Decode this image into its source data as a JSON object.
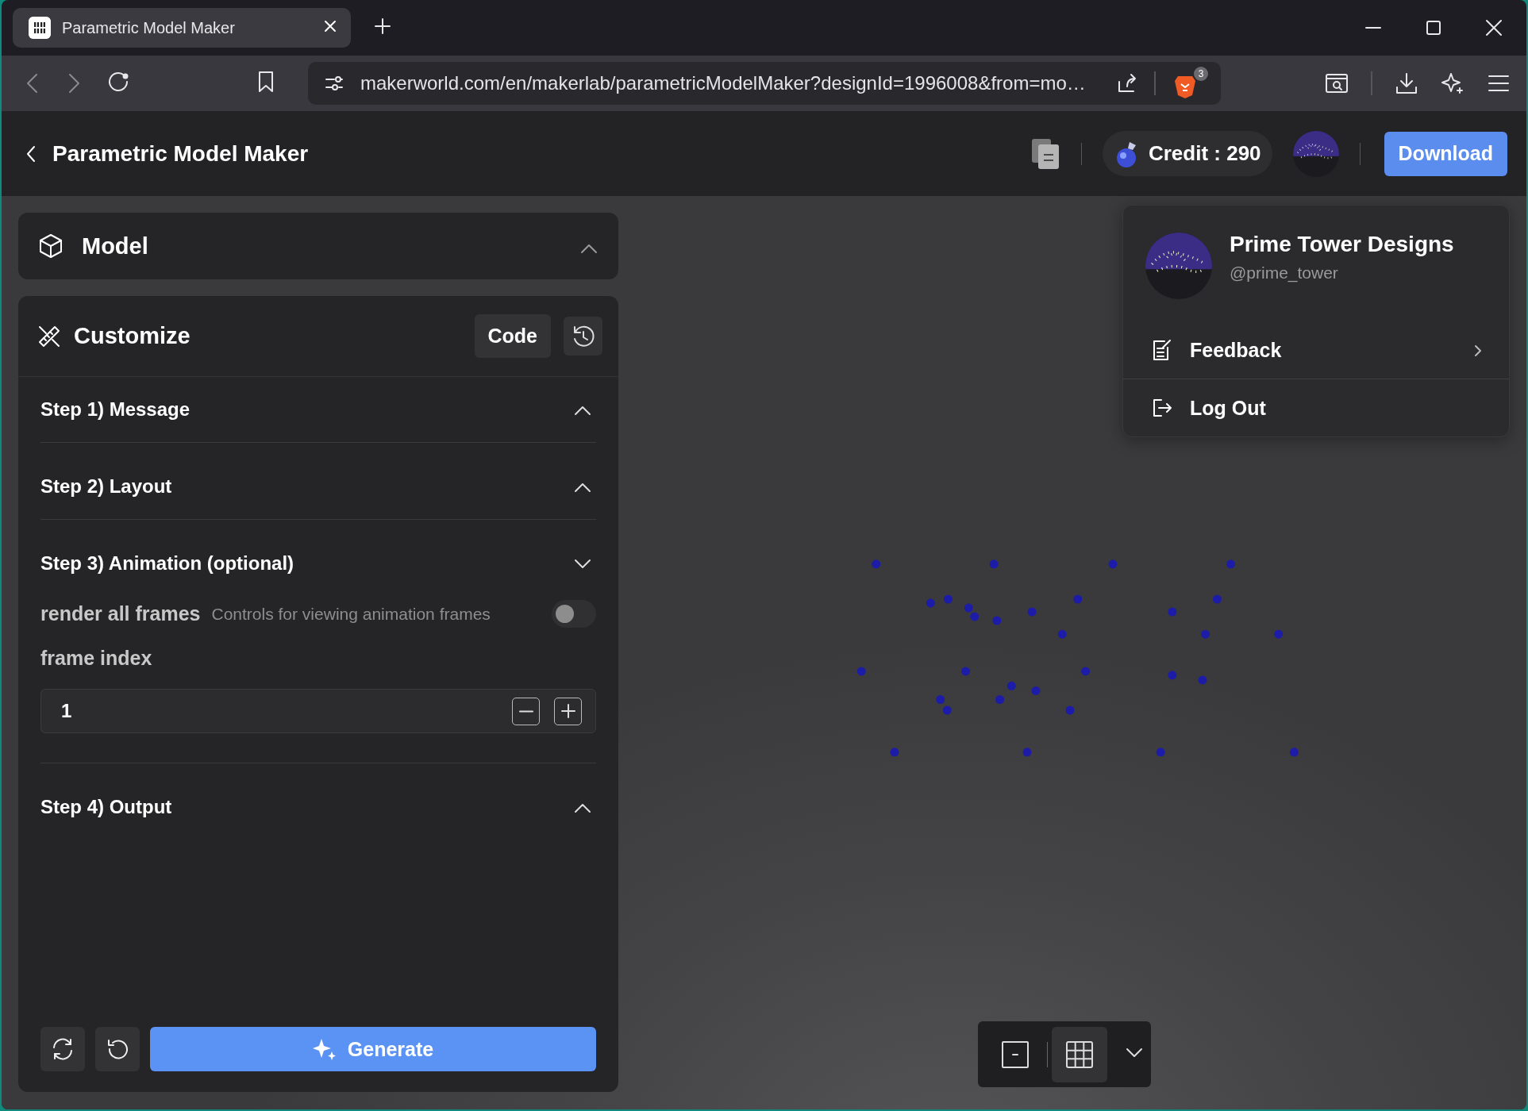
{
  "browser": {
    "tab": {
      "title": "Parametric Model Maker",
      "selected": true
    },
    "url": "makerworld.com/en/makerlab/parametricModelMaker?designId=1996008&from=mo…",
    "shields_count": "3"
  },
  "header": {
    "title": "Parametric Model Maker",
    "credit": "Credit : 290",
    "download": "Download"
  },
  "sidebar": {
    "model": {
      "title": "Model",
      "expanded": false
    },
    "customize": {
      "title": "Customize",
      "code_button": "Code",
      "steps": [
        {
          "title": "Step 1) Message",
          "expanded": false
        },
        {
          "title": "Step 2) Layout",
          "expanded": false
        },
        {
          "title": "Step 3) Animation (optional)",
          "expanded": true,
          "params": [
            {
              "kind": "toggle",
              "label": "render all frames",
              "description": "Controls for viewing animation frames",
              "on": false
            },
            {
              "kind": "number",
              "label": "frame index",
              "value": "1"
            }
          ]
        },
        {
          "title": "Step 4) Output",
          "expanded": false
        }
      ]
    },
    "generate": "Generate"
  },
  "user_menu": {
    "name": "Prime Tower Designs",
    "handle": "@prime_tower",
    "items": [
      {
        "label": "Feedback",
        "kind": "submenu"
      },
      {
        "label": "Log Out",
        "kind": "action"
      }
    ]
  },
  "view_toolbar": {
    "buttons": [
      {
        "kind": "frame",
        "selected": false
      },
      {
        "kind": "grid",
        "selected": true
      }
    ]
  }
}
